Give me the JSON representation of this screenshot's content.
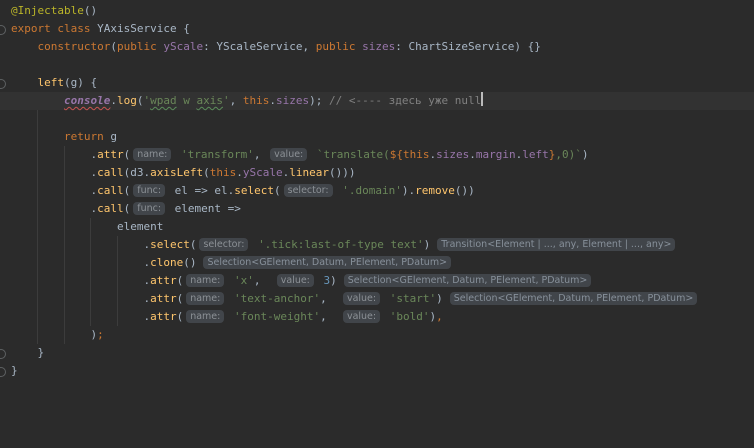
{
  "app": "code-editor",
  "theme": {
    "background": "#2b2b2b",
    "caret_line_background": "#323232",
    "default_text": "#a9b7c6",
    "keyword": "#cc7832",
    "function": "#ffc66d",
    "string": "#6a8759",
    "field": "#9876aa",
    "number": "#6897bb",
    "annotation": "#bbb529",
    "comment": "#808080",
    "hint_pill_background": "#41454a",
    "error_squiggle": "#c75450",
    "typo_squiggle": "#5b8c5a"
  },
  "editor": {
    "language": "TypeScript",
    "caret_position": "end of console.log comment line",
    "lines": [
      {
        "seg": [
          {
            "t": "@Injectable",
            "s": "ann"
          },
          {
            "t": "()",
            "s": "def"
          }
        ]
      },
      {
        "gutter": true,
        "seg": [
          {
            "t": "export class",
            "s": "kw"
          },
          {
            "t": " YAxisService {",
            "s": "def"
          }
        ]
      },
      {
        "seg": [
          {
            "t": "    ",
            "s": "def"
          },
          {
            "t": "constructor",
            "s": "kw"
          },
          {
            "t": "(",
            "s": "def"
          },
          {
            "t": "public",
            "s": "kw"
          },
          {
            "t": " ",
            "s": "def"
          },
          {
            "t": "yScale",
            "s": "fld"
          },
          {
            "t": ": YScaleService, ",
            "s": "def"
          },
          {
            "t": "public",
            "s": "kw"
          },
          {
            "t": " ",
            "s": "def"
          },
          {
            "t": "sizes",
            "s": "fld"
          },
          {
            "t": ": ChartSizeService) {}",
            "s": "def"
          }
        ]
      },
      {
        "seg": []
      },
      {
        "gutter": true,
        "seg": [
          {
            "t": "    ",
            "s": "def"
          },
          {
            "t": "left",
            "s": "fn"
          },
          {
            "t": "(g) {",
            "s": "def"
          }
        ]
      },
      {
        "hl": true,
        "seg": [
          {
            "t": "        ",
            "s": "def"
          },
          {
            "t": "console",
            "s": "glob",
            "u": "red"
          },
          {
            "t": ".",
            "s": "def"
          },
          {
            "t": "log",
            "s": "fn"
          },
          {
            "t": "(",
            "s": "def"
          },
          {
            "t": "'",
            "s": "str"
          },
          {
            "t": "wpad",
            "s": "str",
            "u": "grn"
          },
          {
            "t": " w ",
            "s": "str"
          },
          {
            "t": "axis",
            "s": "str",
            "u": "grn"
          },
          {
            "t": "'",
            "s": "str"
          },
          {
            "t": ", ",
            "s": "def"
          },
          {
            "t": "this",
            "s": "kw"
          },
          {
            "t": ".",
            "s": "def"
          },
          {
            "t": "sizes",
            "s": "fld"
          },
          {
            "t": ");",
            "s": "def"
          },
          {
            "t": " // <---- здесь уже null",
            "s": "cmt"
          },
          {
            "caret": true
          }
        ]
      },
      {
        "seg": []
      },
      {
        "seg": [
          {
            "t": "        ",
            "s": "def"
          },
          {
            "t": "return",
            "s": "kw"
          },
          {
            "t": " g",
            "s": "def"
          }
        ]
      },
      {
        "seg": [
          {
            "t": "            .",
            "s": "def"
          },
          {
            "t": "attr",
            "s": "fn"
          },
          {
            "t": "(",
            "s": "def"
          },
          {
            "hint": "name:"
          },
          {
            "t": " ",
            "s": "def"
          },
          {
            "t": "'transform'",
            "s": "str"
          },
          {
            "t": ", ",
            "s": "def"
          },
          {
            "hint": "value:"
          },
          {
            "t": " ",
            "s": "def"
          },
          {
            "t": "`translate(",
            "s": "str"
          },
          {
            "t": "${",
            "s": "kw"
          },
          {
            "t": "this",
            "s": "kw"
          },
          {
            "t": ".",
            "s": "def"
          },
          {
            "t": "sizes",
            "s": "fld"
          },
          {
            "t": ".",
            "s": "def"
          },
          {
            "t": "margin",
            "s": "fld"
          },
          {
            "t": ".",
            "s": "def"
          },
          {
            "t": "left",
            "s": "fld"
          },
          {
            "t": "}",
            "s": "kw"
          },
          {
            "t": ",0)`",
            "s": "str"
          },
          {
            "t": ")",
            "s": "def"
          }
        ]
      },
      {
        "seg": [
          {
            "t": "            .",
            "s": "def"
          },
          {
            "t": "call",
            "s": "fn"
          },
          {
            "t": "(d3.",
            "s": "def"
          },
          {
            "t": "axisLeft",
            "s": "fn"
          },
          {
            "t": "(",
            "s": "def"
          },
          {
            "t": "this",
            "s": "kw"
          },
          {
            "t": ".",
            "s": "def"
          },
          {
            "t": "yScale",
            "s": "fld"
          },
          {
            "t": ".",
            "s": "def"
          },
          {
            "t": "linear",
            "s": "fn"
          },
          {
            "t": "()))",
            "s": "def"
          }
        ]
      },
      {
        "seg": [
          {
            "t": "            .",
            "s": "def"
          },
          {
            "t": "call",
            "s": "fn"
          },
          {
            "t": "(",
            "s": "def"
          },
          {
            "hint": "func:"
          },
          {
            "t": " el => el.",
            "s": "def"
          },
          {
            "t": "select",
            "s": "fn"
          },
          {
            "t": "(",
            "s": "def"
          },
          {
            "hint": "selector:"
          },
          {
            "t": " ",
            "s": "def"
          },
          {
            "t": "'.domain'",
            "s": "str"
          },
          {
            "t": ").",
            "s": "def"
          },
          {
            "t": "remove",
            "s": "fn"
          },
          {
            "t": "())",
            "s": "def"
          }
        ]
      },
      {
        "seg": [
          {
            "t": "            .",
            "s": "def"
          },
          {
            "t": "call",
            "s": "fn"
          },
          {
            "t": "(",
            "s": "def"
          },
          {
            "hint": "func:"
          },
          {
            "t": " element =>",
            "s": "def"
          }
        ]
      },
      {
        "seg": [
          {
            "t": "                element",
            "s": "def"
          }
        ]
      },
      {
        "seg": [
          {
            "t": "                    .",
            "s": "def"
          },
          {
            "t": "select",
            "s": "fn"
          },
          {
            "t": "(",
            "s": "def"
          },
          {
            "hint": "selector:"
          },
          {
            "t": " ",
            "s": "def"
          },
          {
            "t": "'.tick:last-of-type text'",
            "s": "str"
          },
          {
            "t": ")",
            "s": "def"
          },
          {
            "thint": "Transition<Element | ..., any, Element | ..., any>"
          }
        ]
      },
      {
        "seg": [
          {
            "t": "                    .",
            "s": "def"
          },
          {
            "t": "clone",
            "s": "fn"
          },
          {
            "t": "()",
            "s": "def"
          },
          {
            "thint": "Selection<GElement, Datum, PElement, PDatum>"
          }
        ]
      },
      {
        "seg": [
          {
            "t": "                    .",
            "s": "def"
          },
          {
            "t": "attr",
            "s": "fn"
          },
          {
            "t": "(",
            "s": "def"
          },
          {
            "hint": "name:"
          },
          {
            "t": " ",
            "s": "def"
          },
          {
            "t": "'x'",
            "s": "str"
          },
          {
            "t": ",  ",
            "s": "def"
          },
          {
            "hint": "value:"
          },
          {
            "t": " ",
            "s": "def"
          },
          {
            "t": "3",
            "s": "num"
          },
          {
            "t": ")",
            "s": "def"
          },
          {
            "thint": "Selection<GElement, Datum, PElement, PDatum>"
          }
        ]
      },
      {
        "seg": [
          {
            "t": "                    .",
            "s": "def"
          },
          {
            "t": "attr",
            "s": "fn"
          },
          {
            "t": "(",
            "s": "def"
          },
          {
            "hint": "name:"
          },
          {
            "t": " ",
            "s": "def"
          },
          {
            "t": "'text-anchor'",
            "s": "str"
          },
          {
            "t": ",  ",
            "s": "def"
          },
          {
            "hint": "value:"
          },
          {
            "t": " ",
            "s": "def"
          },
          {
            "t": "'start'",
            "s": "str"
          },
          {
            "t": ")",
            "s": "def"
          },
          {
            "thint": "Selection<GElement, Datum, PElement, PDatum>"
          }
        ]
      },
      {
        "seg": [
          {
            "t": "                    .",
            "s": "def"
          },
          {
            "t": "attr",
            "s": "fn"
          },
          {
            "t": "(",
            "s": "def"
          },
          {
            "hint": "name:"
          },
          {
            "t": " ",
            "s": "def"
          },
          {
            "t": "'font-weight'",
            "s": "str"
          },
          {
            "t": ",  ",
            "s": "def"
          },
          {
            "hint": "value:"
          },
          {
            "t": " ",
            "s": "def"
          },
          {
            "t": "'bold'",
            "s": "str"
          },
          {
            "t": ")",
            "s": "def"
          },
          {
            "t": ",",
            "s": "kw"
          }
        ]
      },
      {
        "seg": [
          {
            "t": "            )",
            "s": "def"
          },
          {
            "t": ";",
            "s": "kw"
          }
        ]
      },
      {
        "gutter": true,
        "seg": [
          {
            "t": "    }",
            "s": "def"
          }
        ]
      },
      {
        "gutter": true,
        "seg": [
          {
            "t": "}",
            "s": "def"
          }
        ]
      }
    ]
  }
}
